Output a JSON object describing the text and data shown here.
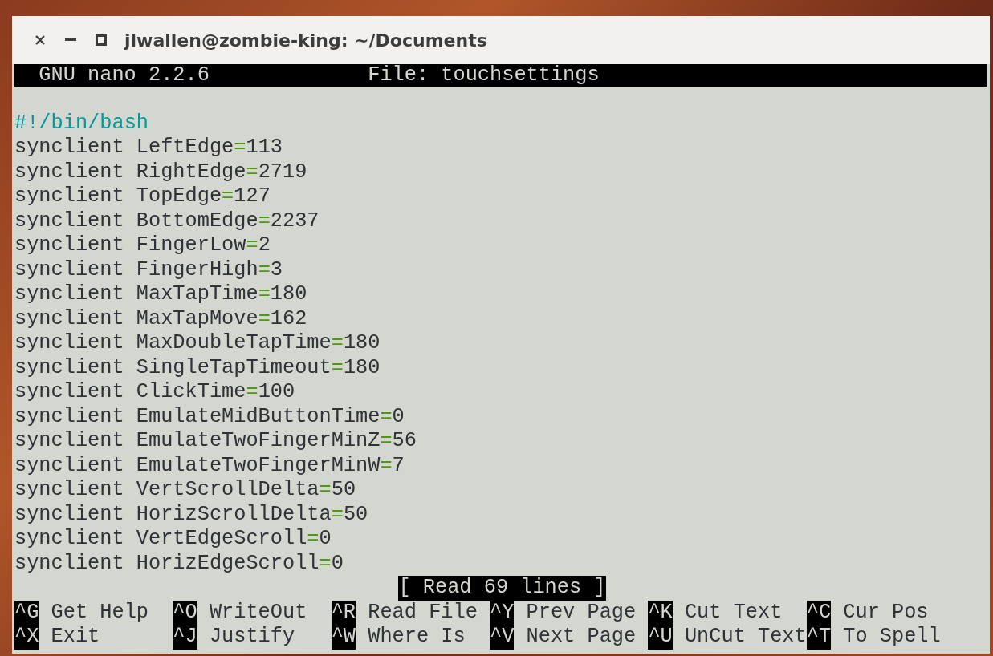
{
  "window": {
    "title": "jlwallen@zombie-king: ~/Documents"
  },
  "header": {
    "version": "GNU nano 2.2.6",
    "file": "File: touchsettings"
  },
  "lines": [
    {
      "kind": "blank"
    },
    {
      "kind": "shebang",
      "text": "#!/bin/bash"
    },
    {
      "kind": "setting",
      "command": "synclient",
      "key": "LeftEdge",
      "operator": "=",
      "value": "113"
    },
    {
      "kind": "setting",
      "command": "synclient",
      "key": "RightEdge",
      "operator": "=",
      "value": "2719"
    },
    {
      "kind": "setting",
      "command": "synclient",
      "key": "TopEdge",
      "operator": "=",
      "value": "127"
    },
    {
      "kind": "setting",
      "command": "synclient",
      "key": "BottomEdge",
      "operator": "=",
      "value": "2237"
    },
    {
      "kind": "setting",
      "command": "synclient",
      "key": "FingerLow",
      "operator": "=",
      "value": "2"
    },
    {
      "kind": "setting",
      "command": "synclient",
      "key": "FingerHigh",
      "operator": "=",
      "value": "3"
    },
    {
      "kind": "setting",
      "command": "synclient",
      "key": "MaxTapTime",
      "operator": "=",
      "value": "180"
    },
    {
      "kind": "setting",
      "command": "synclient",
      "key": "MaxTapMove",
      "operator": "=",
      "value": "162"
    },
    {
      "kind": "setting",
      "command": "synclient",
      "key": "MaxDoubleTapTime",
      "operator": "=",
      "value": "180"
    },
    {
      "kind": "setting",
      "command": "synclient",
      "key": "SingleTapTimeout",
      "operator": "=",
      "value": "180"
    },
    {
      "kind": "setting",
      "command": "synclient",
      "key": "ClickTime",
      "operator": "=",
      "value": "100"
    },
    {
      "kind": "setting",
      "command": "synclient",
      "key": "EmulateMidButtonTime",
      "operator": "=",
      "value": "0"
    },
    {
      "kind": "setting",
      "command": "synclient",
      "key": "EmulateTwoFingerMinZ",
      "operator": "=",
      "value": "56"
    },
    {
      "kind": "setting",
      "command": "synclient",
      "key": "EmulateTwoFingerMinW",
      "operator": "=",
      "value": "7"
    },
    {
      "kind": "setting",
      "command": "synclient",
      "key": "VertScrollDelta",
      "operator": "=",
      "value": "50"
    },
    {
      "kind": "setting",
      "command": "synclient",
      "key": "HorizScrollDelta",
      "operator": "=",
      "value": "50"
    },
    {
      "kind": "setting",
      "command": "synclient",
      "key": "VertEdgeScroll",
      "operator": "=",
      "value": "0"
    },
    {
      "kind": "setting",
      "command": "synclient",
      "key": "HorizEdgeScroll",
      "operator": "=",
      "value": "0"
    }
  ],
  "status": "[ Read 69 lines ]",
  "shortcuts": [
    [
      {
        "key": "^G",
        "label": "Get Help"
      },
      {
        "key": "^O",
        "label": "WriteOut"
      },
      {
        "key": "^R",
        "label": "Read File"
      },
      {
        "key": "^Y",
        "label": "Prev Page"
      },
      {
        "key": "^K",
        "label": "Cut Text"
      },
      {
        "key": "^C",
        "label": "Cur Pos"
      }
    ],
    [
      {
        "key": "^X",
        "label": "Exit"
      },
      {
        "key": "^J",
        "label": "Justify"
      },
      {
        "key": "^W",
        "label": "Where Is"
      },
      {
        "key": "^V",
        "label": "Next Page"
      },
      {
        "key": "^U",
        "label": "UnCut Text"
      },
      {
        "key": "^T",
        "label": "To Spell"
      }
    ]
  ]
}
